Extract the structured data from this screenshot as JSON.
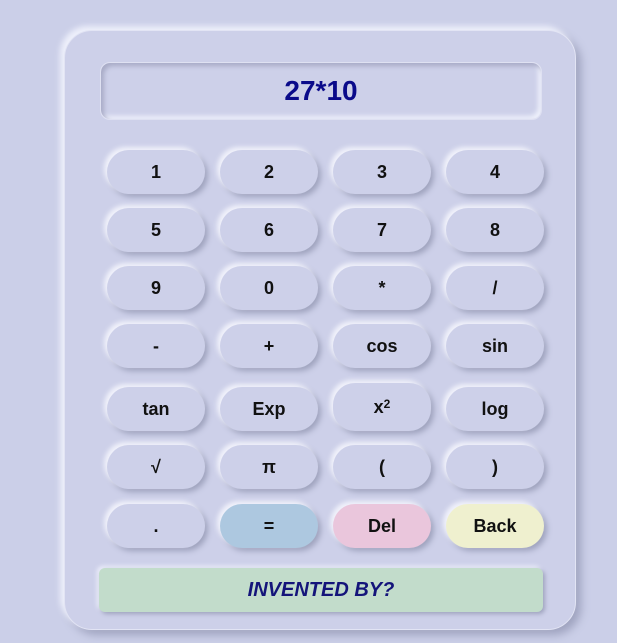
{
  "display": {
    "expression": "27*10"
  },
  "keys": {
    "k1": "1",
    "k2": "2",
    "k3": "3",
    "k4": "4",
    "k5": "5",
    "k6": "6",
    "k7": "7",
    "k8": "8",
    "k9": "9",
    "k0": "0",
    "multiply": "*",
    "divide": "/",
    "minus": "-",
    "plus": "+",
    "cos": "cos",
    "sin": "sin",
    "tan": "tan",
    "exp": "Exp",
    "square_base": "x",
    "square_exp": "2",
    "log": "log",
    "sqrt": "√",
    "pi": "π",
    "lparen": "(",
    "rparen": ")",
    "dot": ".",
    "equals": "=",
    "del": "Del",
    "back": "Back"
  },
  "footer": {
    "label": "INVENTED BY?"
  },
  "colors": {
    "background": "#cbcfe8",
    "equals_key": "#adc8e0",
    "del_key": "#eac6dc",
    "back_key": "#eff0cf",
    "footer_bg": "#c2dccb",
    "display_text": "#0a0a8a"
  }
}
